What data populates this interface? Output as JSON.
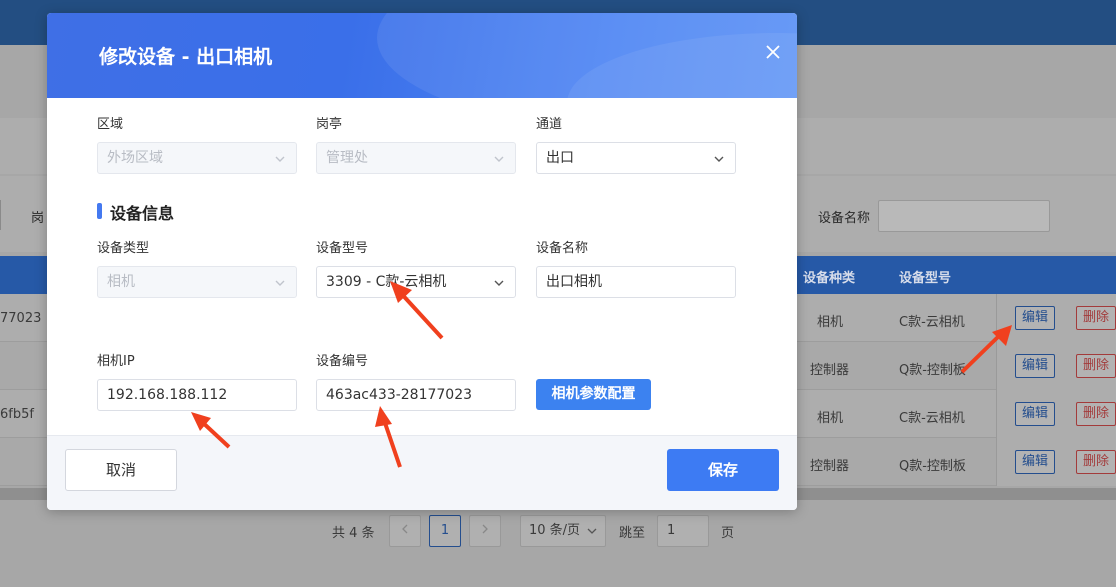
{
  "background": {
    "filter": {
      "label_left": "岗",
      "label_device_name": "设备名称"
    },
    "table": {
      "headers": {
        "device_kind": "设备种类",
        "device_model": "设备型号"
      },
      "rows": [
        {
          "left": "77023",
          "kind": "相机",
          "model": "C款-云相机"
        },
        {
          "left": "",
          "kind": "控制器",
          "model": "Q款-控制板"
        },
        {
          "left": "6fb5f",
          "kind": "相机",
          "model": "C款-云相机"
        },
        {
          "left": "",
          "kind": "控制器",
          "model": "Q款-控制板"
        }
      ],
      "edit_label": "编辑",
      "delete_label": "删除"
    },
    "pager": {
      "total": "共 4 条",
      "current_page": "1",
      "page_size": "10 条/页",
      "jump_label": "跳至",
      "jump_value": "1",
      "page_unit": "页"
    }
  },
  "modal": {
    "title": "修改设备 - 出口相机",
    "fields": {
      "area": {
        "label": "区域",
        "value": "外场区域"
      },
      "booth": {
        "label": "岗亭",
        "value": "管理处"
      },
      "channel": {
        "label": "通道",
        "value": "出口"
      },
      "device_type": {
        "label": "设备类型",
        "value": "相机"
      },
      "device_model": {
        "label": "设备型号",
        "value": "3309 - C款-云相机"
      },
      "device_name": {
        "label": "设备名称",
        "value": "出口相机"
      },
      "camera_ip": {
        "label": "相机IP",
        "value": "192.168.188.112"
      },
      "device_sn": {
        "label": "设备编号",
        "value": "463ac433-28177023"
      }
    },
    "section_title": "设备信息",
    "camera_config_button": "相机参数配置",
    "cancel_label": "取消",
    "save_label": "保存"
  },
  "colors": {
    "primary": "#3d7bf3",
    "annotation_arrow": "#f0401e"
  },
  "icons": {
    "close": "close-icon",
    "dropdown": "chevron-down-icon"
  }
}
